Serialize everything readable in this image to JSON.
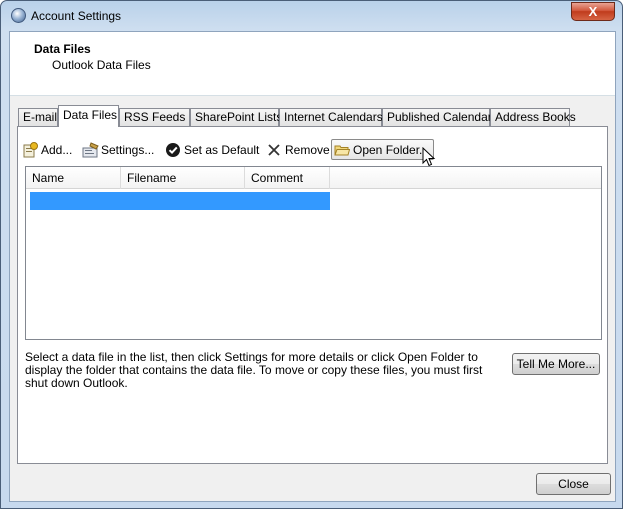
{
  "window": {
    "title": "Account Settings",
    "close_glyph": "X"
  },
  "header": {
    "title": "Data Files",
    "subtitle": "Outlook Data Files"
  },
  "tabs": [
    {
      "label": "E-mail",
      "active": false
    },
    {
      "label": "Data Files",
      "active": true
    },
    {
      "label": "RSS Feeds",
      "active": false
    },
    {
      "label": "SharePoint Lists",
      "active": false
    },
    {
      "label": "Internet Calendars",
      "active": false
    },
    {
      "label": "Published Calendars",
      "active": false
    },
    {
      "label": "Address Books",
      "active": false
    }
  ],
  "toolbar": {
    "add": {
      "label": "Add...",
      "icon": "add-icon"
    },
    "settings": {
      "label": "Settings...",
      "icon": "settings-icon"
    },
    "set_default": {
      "label": "Set as Default",
      "icon": "checkmark-icon"
    },
    "remove": {
      "label": "Remove",
      "icon": "remove-x-icon"
    },
    "open_folder": {
      "label": "Open Folder...",
      "icon": "folder-icon"
    }
  },
  "list": {
    "columns": [
      "Name",
      "Filename",
      "Comment"
    ],
    "rows": [
      {
        "name": "",
        "filename": "",
        "comment": "",
        "selected": true
      }
    ]
  },
  "info_text": "Select a data file in the list, then click Settings for more details or click Open Folder to display the folder that contains the data file. To move or copy these files, you must first shut down Outlook.",
  "buttons": {
    "tell_me_more": "Tell Me More...",
    "close": "Close"
  },
  "colors": {
    "selection": "#3399ff",
    "title_bar": "#b9d1ea",
    "close_button": "#c03b1c"
  }
}
